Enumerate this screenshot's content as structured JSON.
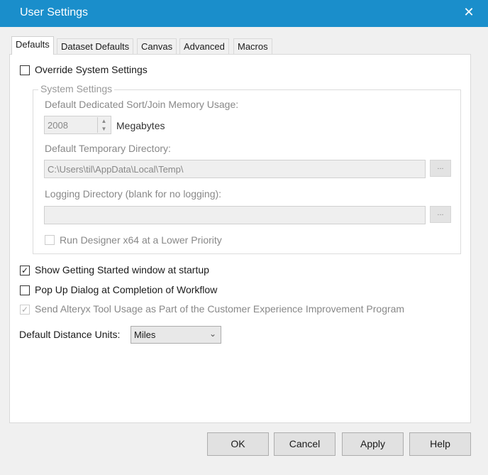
{
  "window": {
    "title": "User Settings",
    "close": "✕"
  },
  "tabs": [
    "Defaults",
    "Dataset Defaults",
    "Canvas",
    "Advanced",
    "Macros"
  ],
  "override": {
    "label": "Override System Settings",
    "checked": false
  },
  "system": {
    "title": "System Settings",
    "memory_label": "Default Dedicated Sort/Join Memory Usage:",
    "memory_value": "2008",
    "memory_unit": "Megabytes",
    "temp_label": "Default Temporary Directory:",
    "temp_value": "C:\\Users\\til\\AppData\\Local\\Temp\\",
    "log_label": "Logging Directory (blank for no logging):",
    "log_value": "",
    "browse": "...",
    "lowprio_label": "Run Designer x64 at a Lower Priority"
  },
  "options": {
    "getting_started": {
      "label": "Show Getting Started window at startup",
      "checked": true
    },
    "popup": {
      "label": "Pop Up Dialog at Completion of Workflow",
      "checked": false
    },
    "usage": {
      "label": "Send Alteryx Tool Usage as Part of the Customer Experience Improvement Program",
      "checked": true
    }
  },
  "distance": {
    "label": "Default Distance Units:",
    "value": "Miles"
  },
  "buttons": {
    "ok": "OK",
    "cancel": "Cancel",
    "apply": "Apply",
    "help": "Help"
  },
  "colors": {
    "titlebar": "#1a8ecb"
  }
}
